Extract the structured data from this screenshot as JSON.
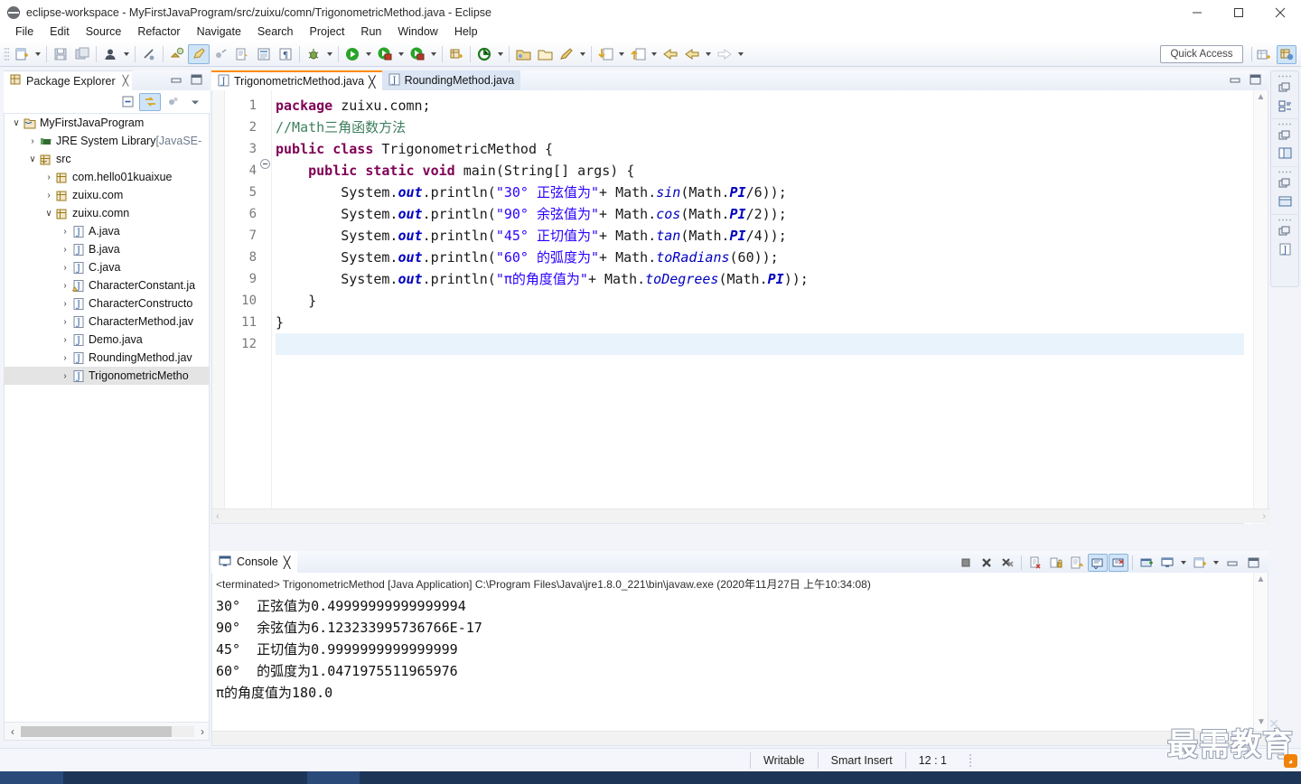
{
  "window": {
    "title": "eclipse-workspace - MyFirstJavaProgram/src/zuixu/comn/TrigonometricMethod.java - Eclipse",
    "icon": "eclipse-icon",
    "minimize": "minimize-button",
    "maximize": "maximize-button",
    "close": "close-button"
  },
  "menubar": {
    "items": [
      "File",
      "Edit",
      "Source",
      "Refactor",
      "Navigate",
      "Search",
      "Project",
      "Run",
      "Window",
      "Help"
    ]
  },
  "toolbar": {
    "quick_access_placeholder": "Quick Access",
    "buttons": [
      "new-wizard-icon",
      "save-icon",
      "save-all-icon",
      "user-icon",
      "skip-breakpoints-icon",
      "toggle-mark-occurrences-icon",
      "annotations-icon",
      "next-annotation-icon",
      "open-type-icon",
      "open-task-icon",
      "pilcrow-icon",
      "debug-icon",
      "run-icon",
      "run-last-tool-icon",
      "external-tools-icon",
      "new-java-package-icon"
    ],
    "buttons2": [
      "coverage-icon",
      "open-folder-icon",
      "open-resource-icon",
      "pencil-icon",
      "import-icon",
      "export-icon",
      "back-icon",
      "previous-edit-icon",
      "forward-icon"
    ],
    "perspective_open": "open-perspective-icon",
    "perspective_java": "java-perspective-icon"
  },
  "package_explorer": {
    "tab_title": "Package Explorer",
    "tab_icon": "package-explorer-icon",
    "close_glyph": "╳",
    "tools": [
      "collapse-all-icon",
      "link-with-editor-icon",
      "focus-on-active-task-icon",
      "view-menu-icon"
    ],
    "tree": [
      {
        "label": "MyFirstJavaProgram",
        "depth": 0,
        "twist": "∨",
        "icon": "java-project-icon",
        "selected": false,
        "suffix": ""
      },
      {
        "label": "JRE System Library ",
        "depth": 1,
        "twist": "›",
        "icon": "library-icon",
        "selected": false,
        "suffix": "[JavaSE-"
      },
      {
        "label": "src",
        "depth": 1,
        "twist": "∨",
        "icon": "source-folder-icon",
        "selected": false,
        "suffix": ""
      },
      {
        "label": "com.hello01kuaixue",
        "depth": 2,
        "twist": "›",
        "icon": "package-icon",
        "selected": false,
        "suffix": ""
      },
      {
        "label": "zuixu.com",
        "depth": 2,
        "twist": "›",
        "icon": "package-icon",
        "selected": false,
        "suffix": ""
      },
      {
        "label": "zuixu.comn",
        "depth": 2,
        "twist": "∨",
        "icon": "package-icon",
        "selected": false,
        "suffix": ""
      },
      {
        "label": "A.java",
        "depth": 3,
        "twist": "›",
        "icon": "java-file-icon",
        "selected": false,
        "suffix": ""
      },
      {
        "label": "B.java",
        "depth": 3,
        "twist": "›",
        "icon": "java-file-icon",
        "selected": false,
        "suffix": ""
      },
      {
        "label": "C.java",
        "depth": 3,
        "twist": "›",
        "icon": "java-file-icon",
        "selected": false,
        "suffix": ""
      },
      {
        "label": "CharacterConstant.ja",
        "depth": 3,
        "twist": "›",
        "icon": "java-file-warning-icon",
        "selected": false,
        "suffix": ""
      },
      {
        "label": "CharacterConstructo",
        "depth": 3,
        "twist": "›",
        "icon": "java-file-icon",
        "selected": false,
        "suffix": ""
      },
      {
        "label": "CharacterMethod.jav",
        "depth": 3,
        "twist": "›",
        "icon": "java-file-icon",
        "selected": false,
        "suffix": ""
      },
      {
        "label": "Demo.java",
        "depth": 3,
        "twist": "›",
        "icon": "java-file-icon",
        "selected": false,
        "suffix": ""
      },
      {
        "label": "RoundingMethod.jav",
        "depth": 3,
        "twist": "›",
        "icon": "java-file-icon",
        "selected": false,
        "suffix": ""
      },
      {
        "label": "TrigonometricMetho",
        "depth": 3,
        "twist": "›",
        "icon": "java-file-icon",
        "selected": true,
        "suffix": ""
      }
    ],
    "hscroll_left": "‹",
    "hscroll_right": "›"
  },
  "editor": {
    "tabs": [
      {
        "label": "TrigonometricMethod.java",
        "icon": "java-file-icon",
        "active": true,
        "close_glyph": "╳"
      },
      {
        "label": "RoundingMethod.java",
        "icon": "java-file-icon",
        "active": false,
        "close_glyph": ""
      }
    ],
    "line_numbers": [
      "1",
      "2",
      "3",
      "4",
      "5",
      "6",
      "7",
      "8",
      "9",
      "10",
      "11",
      "12"
    ],
    "current_line": 12,
    "code_lines": [
      [
        {
          "t": "package ",
          "c": "kw"
        },
        {
          "t": "zuixu.comn;",
          "c": ""
        }
      ],
      [
        {
          "t": "//Math三角函数方法",
          "c": "cmt"
        }
      ],
      [
        {
          "t": "public class ",
          "c": "kw"
        },
        {
          "t": "TrigonometricMethod {",
          "c": ""
        }
      ],
      [
        {
          "t": "    ",
          "c": ""
        },
        {
          "t": "public static void ",
          "c": "kw"
        },
        {
          "t": "main(String[] args) {",
          "c": ""
        }
      ],
      [
        {
          "t": "        System.",
          "c": ""
        },
        {
          "t": "out",
          "c": "fld"
        },
        {
          "t": ".println(",
          "c": ""
        },
        {
          "t": "\"30° 正弦值为\"",
          "c": "str"
        },
        {
          "t": "+ Math.",
          "c": ""
        },
        {
          "t": "sin",
          "c": "mth"
        },
        {
          "t": "(Math.",
          "c": ""
        },
        {
          "t": "PI",
          "c": "fld"
        },
        {
          "t": "/6));",
          "c": ""
        }
      ],
      [
        {
          "t": "        System.",
          "c": ""
        },
        {
          "t": "out",
          "c": "fld"
        },
        {
          "t": ".println(",
          "c": ""
        },
        {
          "t": "\"90° 余弦值为\"",
          "c": "str"
        },
        {
          "t": "+ Math.",
          "c": ""
        },
        {
          "t": "cos",
          "c": "mth"
        },
        {
          "t": "(Math.",
          "c": ""
        },
        {
          "t": "PI",
          "c": "fld"
        },
        {
          "t": "/2));",
          "c": ""
        }
      ],
      [
        {
          "t": "        System.",
          "c": ""
        },
        {
          "t": "out",
          "c": "fld"
        },
        {
          "t": ".println(",
          "c": ""
        },
        {
          "t": "\"45° 正切值为\"",
          "c": "str"
        },
        {
          "t": "+ Math.",
          "c": ""
        },
        {
          "t": "tan",
          "c": "mth"
        },
        {
          "t": "(Math.",
          "c": ""
        },
        {
          "t": "PI",
          "c": "fld"
        },
        {
          "t": "/4));",
          "c": ""
        }
      ],
      [
        {
          "t": "        System.",
          "c": ""
        },
        {
          "t": "out",
          "c": "fld"
        },
        {
          "t": ".println(",
          "c": ""
        },
        {
          "t": "\"60° 的弧度为\"",
          "c": "str"
        },
        {
          "t": "+ Math.",
          "c": ""
        },
        {
          "t": "toRadians",
          "c": "mth"
        },
        {
          "t": "(60));",
          "c": ""
        }
      ],
      [
        {
          "t": "        System.",
          "c": ""
        },
        {
          "t": "out",
          "c": "fld"
        },
        {
          "t": ".println(",
          "c": ""
        },
        {
          "t": "\"π的角度值为\"",
          "c": "str"
        },
        {
          "t": "+ Math.",
          "c": ""
        },
        {
          "t": "toDegrees",
          "c": "mth"
        },
        {
          "t": "(Math.",
          "c": ""
        },
        {
          "t": "PI",
          "c": "fld"
        },
        {
          "t": "));",
          "c": ""
        }
      ],
      [
        {
          "t": "    }",
          "c": ""
        }
      ],
      [
        {
          "t": "}",
          "c": ""
        }
      ],
      [
        {
          "t": "",
          "c": ""
        }
      ]
    ],
    "minimize": "minimize-button",
    "maximize": "maximize-button"
  },
  "console": {
    "tab_title": "Console",
    "tab_icon": "console-icon",
    "close_glyph": "╳",
    "header": "<terminated> TrigonometricMethod [Java Application] C:\\Program Files\\Java\\jre1.8.0_221\\bin\\javaw.exe (2020年11月27日 上午10:34:08)",
    "output_lines": [
      "30°  正弦值为0.49999999999999994",
      "90°  余弦值为6.123233995736766E-17",
      "45°  正切值为0.9999999999999999",
      "60°  的弧度为1.0471975511965976",
      "π的角度值为180.0"
    ],
    "tools": [
      "terminate-icon",
      "remove-launch-icon",
      "remove-all-terminated-icon",
      "clear-console-icon",
      "scroll-lock-icon",
      "word-wrap-icon",
      "show-console-on-output-icon",
      "show-console-on-error-icon",
      "pin-console-icon",
      "display-selected-console-icon",
      "display-selected-console-arrow",
      "open-console-icon",
      "open-console-arrow"
    ],
    "minimize": "minimize-button",
    "maximize": "maximize-button"
  },
  "fastbar": {
    "groups": [
      {
        "restore": "restore-icon",
        "view": "package-explorer-icon"
      },
      {
        "restore": "restore-icon",
        "view": "outline-view-icon"
      },
      {
        "restore": "restore-icon",
        "view": "console-view-icon"
      },
      {
        "restore": "restore-icon",
        "view": "java-file-icon"
      }
    ]
  },
  "statusbar": {
    "writable": "Writable",
    "insert_mode": "Smart Insert",
    "position": "12 : 1"
  },
  "watermark": {
    "text": "最需教育",
    "badge": "rss-icon"
  },
  "colors": {
    "accent": "#cfe4f7",
    "accent_border": "#8ab4dd",
    "keyword": "#7f0055",
    "string": "#2a00ff",
    "comment": "#3f7f5f",
    "field": "#0000c0",
    "tab_active_top": "#ff8c00",
    "selection": "#e4e4e4"
  }
}
